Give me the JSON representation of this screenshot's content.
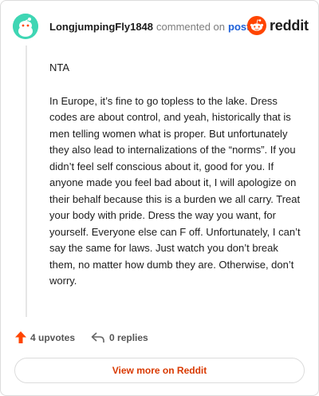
{
  "header": {
    "username": "LongjumpingFly1848",
    "commented_on": "commented on",
    "post_link": "post",
    "brand": "reddit"
  },
  "comment": {
    "paragraphs": [
      "NTA",
      "In Europe, it’s fine to go topless to the lake. Dress codes are about control, and yeah, historically that is men telling women what is proper. But unfortunately they also lead to internalizations of the “norms”. If you didn’t feel self conscious about it, good for you. If anyone made you feel bad about it, I will apologize on their behalf because this is a burden we all carry. Treat your body with pride. Dress the way you want, for yourself. Everyone else can F off. Unfortunately, I can’t say the same for laws. Just watch you don’t break them, no matter how dumb they are. Otherwise, don’t worry."
    ]
  },
  "footer": {
    "upvotes": "4 upvotes",
    "replies": "0 replies",
    "view_more": "View more on Reddit"
  },
  "icons": {
    "avatar": "snoo-avatar-icon",
    "logo": "reddit-logo-icon",
    "upvote": "upvote-arrow-icon",
    "reply": "reply-arrow-icon"
  },
  "colors": {
    "brand": "#ff4500",
    "link": "#1c5fd8",
    "view_more_text": "#d93900",
    "avatar_bg": "#3fd6b4"
  }
}
